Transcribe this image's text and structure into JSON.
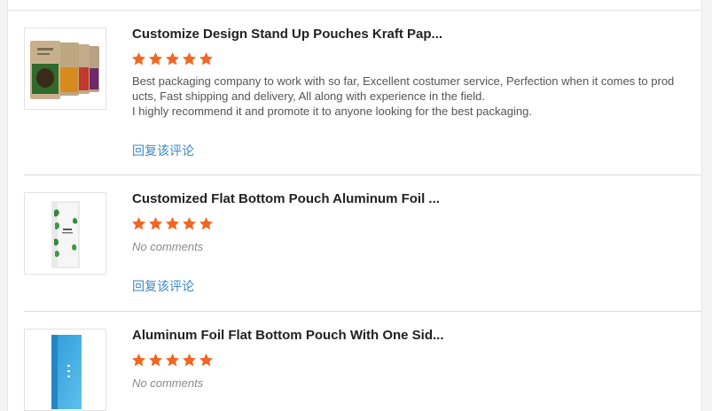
{
  "reviews": [
    {
      "title": "Customize Design Stand Up Pouches Kraft Pap...",
      "rating": 5,
      "comment_lines": [
        "Best packaging company to work with so far, Excellent costumer service, Perfection when it comes to prod",
        "ucts, Fast shipping and delivery, All along with experience in the field.",
        "I highly recommend it and promote it to anyone looking for the best packaging."
      ],
      "reply_label": "回复该评论",
      "image_icon": "kraft-stand-up-pouches-image"
    },
    {
      "title": "Customized Flat Bottom Pouch Aluminum Foil ...",
      "rating": 5,
      "comment": "No comments",
      "reply_label": "回复该评论",
      "image_icon": "flat-bottom-pouch-image"
    },
    {
      "title": "Aluminum Foil Flat Bottom Pouch With One Sid...",
      "rating": 5,
      "comment": "No comments",
      "image_icon": "blue-foil-pouch-image"
    }
  ],
  "colors": {
    "star": "#f26522",
    "reply_link": "#3b87c4",
    "title": "#222222"
  }
}
